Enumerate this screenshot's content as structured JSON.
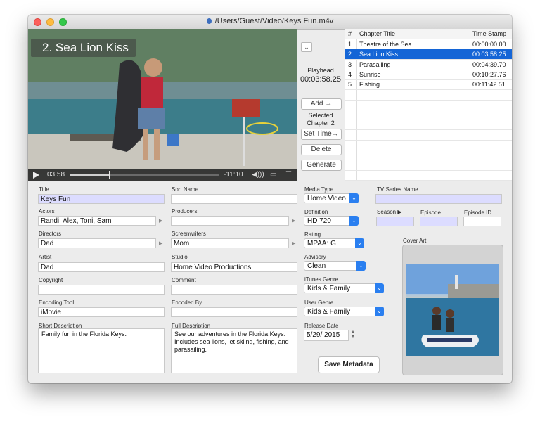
{
  "window": {
    "title": "/Users/Guest/Video/Keys Fun.m4v"
  },
  "video": {
    "chapter_overlay": "2. Sea Lion Kiss",
    "elapsed": "03:58",
    "remaining": "-11:10",
    "progress": 0.26
  },
  "controls": {
    "playhead_label": "Playhead",
    "playhead_value": "00:03:58.25",
    "add_label": "Add →",
    "selected_label": "Selected",
    "selected_value": "Chapter 2",
    "set_time_label": "Set Time→",
    "delete_label": "Delete",
    "generate_label": "Generate"
  },
  "chapters": {
    "headers": {
      "num": "#",
      "title": "Chapter Title",
      "time": "Time Stamp"
    },
    "rows": [
      {
        "num": "1",
        "title": "Theatre of the Sea",
        "time": "00:00:00.00"
      },
      {
        "num": "2",
        "title": "Sea Lion Kiss",
        "time": "00:03:58.25"
      },
      {
        "num": "3",
        "title": "Parasailing",
        "time": "00:04:39.70"
      },
      {
        "num": "4",
        "title": "Sunrise",
        "time": "00:10:27.76"
      },
      {
        "num": "5",
        "title": "Fishing",
        "time": "00:11:42.51"
      }
    ],
    "selected_index": 1
  },
  "metadata": {
    "title_label": "Title",
    "title_value": "Keys Fun",
    "sort_name_label": "Sort Name",
    "sort_name_value": "",
    "actors_label": "Actors",
    "actors_value": "Randi, Alex, Toni, Sam",
    "producers_label": "Producers",
    "producers_value": "",
    "directors_label": "Directors",
    "directors_value": "Dad",
    "screenwriters_label": "Screenwriters",
    "screenwriters_value": "Mom",
    "artist_label": "Artist",
    "artist_value": "Dad",
    "studio_label": "Studio",
    "studio_value": "Home Video Productions",
    "copyright_label": "Copyright",
    "copyright_value": "",
    "comment_label": "Comment",
    "comment_value": "",
    "encoding_tool_label": "Encoding Tool",
    "encoding_tool_value": "iMovie",
    "encoded_by_label": "Encoded By",
    "encoded_by_value": "",
    "short_desc_label": "Short Description",
    "short_desc_value": "Family fun in the Florida Keys.",
    "full_desc_label": "Full Description",
    "full_desc_value": "See our adventures in the Florida Keys. Includes sea lions, jet skiing, fishing, and parasailing."
  },
  "right_panel": {
    "media_type_label": "Media Type",
    "media_type_value": "Home Video",
    "tv_series_label": "TV Series Name",
    "tv_series_value": "",
    "definition_label": "Definition",
    "definition_value": "HD 720",
    "season_label": "Season ▶",
    "episode_label": "Episode",
    "episode_id_label": "Episode ID",
    "rating_label": "Rating",
    "rating_value": "MPAA: G",
    "cover_art_label": "Cover Art",
    "advisory_label": "Advisory",
    "advisory_value": "Clean",
    "itunes_genre_label": "iTunes Genre",
    "itunes_genre_value": "Kids & Family",
    "user_genre_label": "User Genre",
    "user_genre_value": "Kids & Family",
    "release_date_label": "Release Date",
    "release_date_value": "5/29/ 2015",
    "save_label": "Save Metadata"
  }
}
